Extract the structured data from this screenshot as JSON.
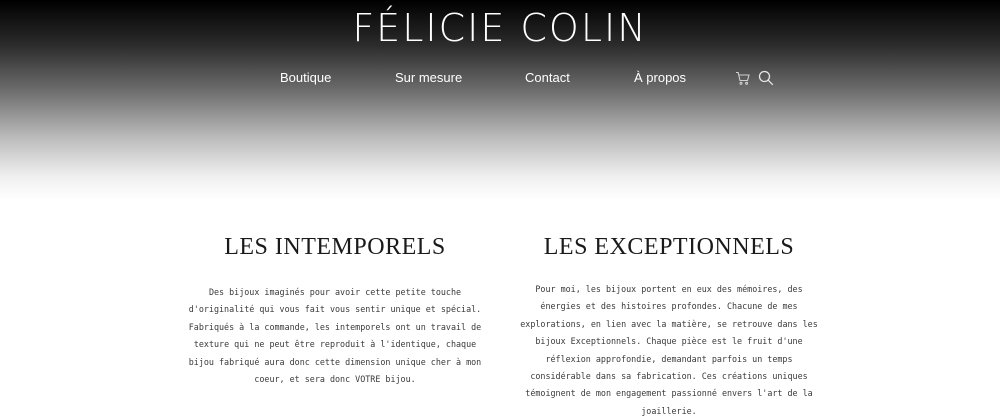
{
  "header": {
    "logo_text": "FÉLICIE COLIN",
    "nav": [
      {
        "label": "Boutique"
      },
      {
        "label": "Sur mesure"
      },
      {
        "label": "Contact"
      },
      {
        "label": "À propos"
      }
    ],
    "icons": [
      "cart-icon",
      "search-icon"
    ]
  },
  "sections": [
    {
      "title": "LES INTEMPORELS",
      "text": "Des bijoux imaginés pour avoir cette petite touche d'originalité qui vous fait vous sentir unique et spécial. Fabriqués à la commande, les intemporels ont un travail de texture qui ne peut être reproduit à l'identique, chaque bijou fabriqué aura donc cette dimension unique cher à mon coeur, et sera donc VOTRE bijou."
    },
    {
      "title": "LES EXCEPTIONNELS",
      "text": "Pour moi, les bijoux portent en eux des mémoires, des énergies et des histoires profondes. Chacune de mes explorations, en lien avec la matière, se retrouve dans les bijoux Exceptionnels. Chaque pièce est le fruit d'une réflexion approfondie, demandant parfois un temps considérable dans sa fabrication. Ces créations uniques témoignent de mon engagement passionné envers l'art de la joaillerie."
    }
  ],
  "colors": {
    "header_top": "#000000",
    "header_bottom": "#ffffff",
    "nav_text": "#ffffff",
    "title_text": "#1a1a1a",
    "body_text": "#3a3a3a"
  }
}
